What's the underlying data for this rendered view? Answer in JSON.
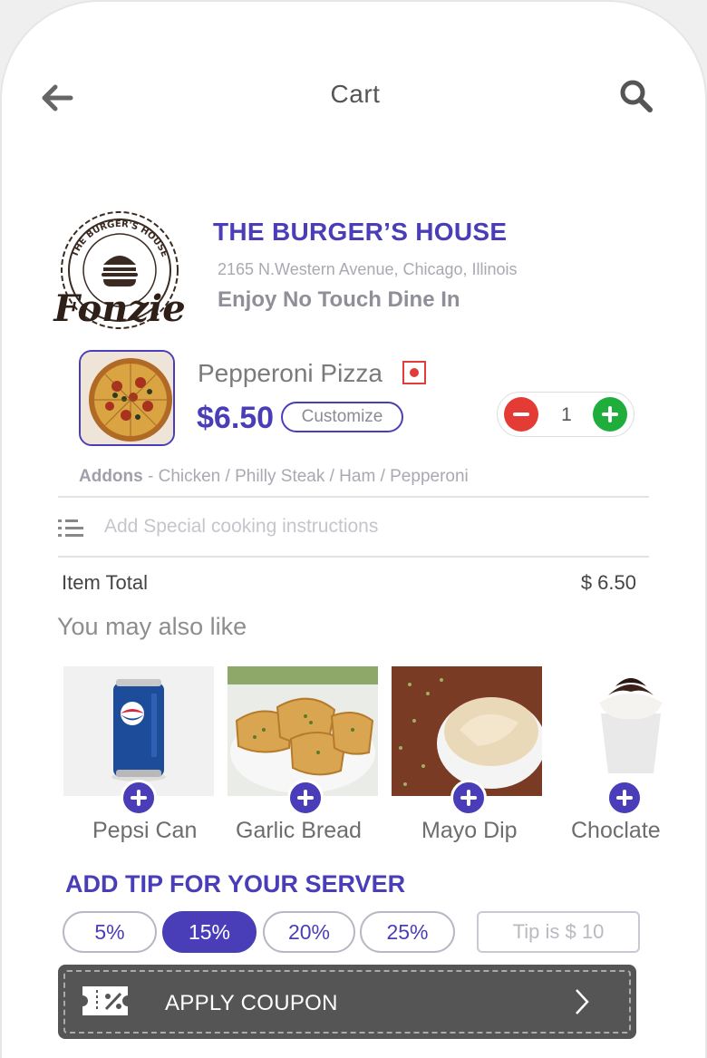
{
  "header": {
    "title": "Cart",
    "back_icon": "back-arrow-icon",
    "search_icon": "search-icon"
  },
  "restaurant": {
    "logo_text_top": "THE BURGER'S HOUSE",
    "logo_text_script": "Fonzie",
    "name": "THE BURGER’S HOUSE",
    "address": "2165 N.Western Avenue, Chicago, Illinois",
    "tagline": "Enjoy No Touch Dine In"
  },
  "cart_item": {
    "name": "Pepperoni Pizza",
    "price": "$6.50",
    "customize_label": "Customize",
    "quantity": "1",
    "addons_label": "Addons",
    "addons_list": " - Chicken / Philly Steak / Ham / Pepperoni",
    "veg_indicator_color": "#e23b3b"
  },
  "instructions": {
    "placeholder": "Add Special cooking instructions"
  },
  "totals": {
    "item_total_label": "Item Total",
    "item_total_value": "$ 6.50"
  },
  "suggestions": {
    "title": "You may also like",
    "items": [
      {
        "label": "Pepsi Can"
      },
      {
        "label": "Garlic Bread"
      },
      {
        "label": "Mayo Dip"
      },
      {
        "label": "Choclate"
      }
    ]
  },
  "tip": {
    "title": "ADD TIP FOR YOUR SERVER",
    "options": [
      "5%",
      "15%",
      "20%",
      "25%"
    ],
    "selected": "15%",
    "custom_placeholder": "Tip is $ 10"
  },
  "coupon": {
    "label": "APPLY COUPON"
  },
  "colors": {
    "brand": "#4a3eb8",
    "minus": "#e53b35",
    "plus": "#1fae3c",
    "coupon_bg": "#555555"
  }
}
